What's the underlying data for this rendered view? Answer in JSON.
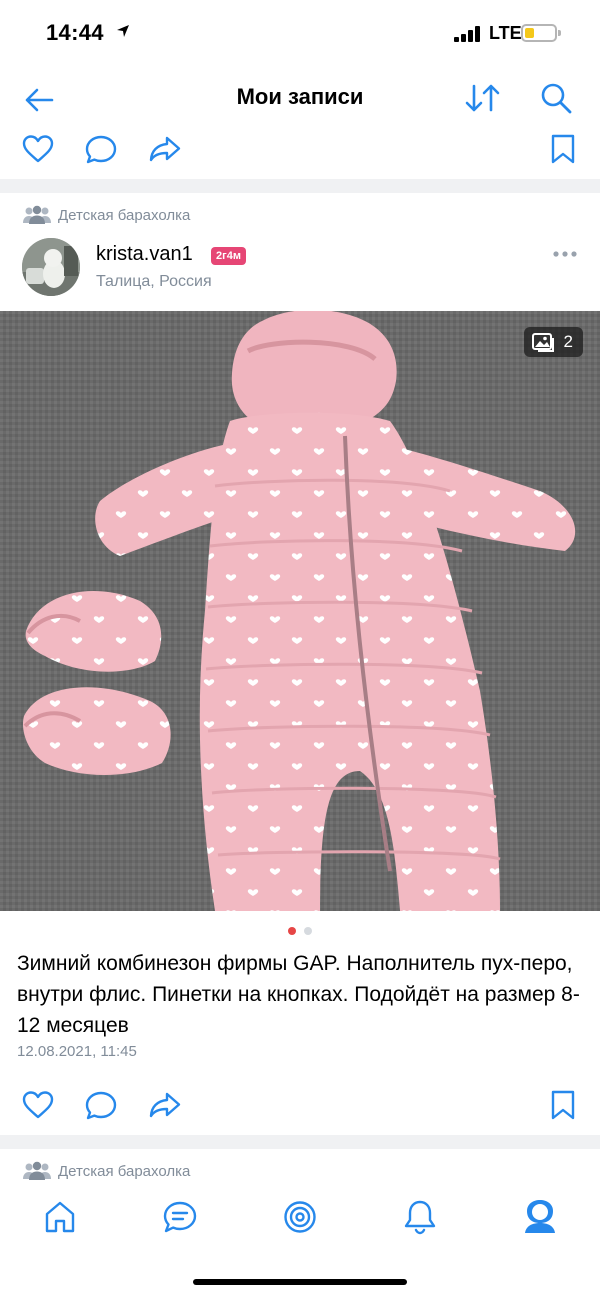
{
  "status_bar": {
    "time": "14:44",
    "network": "LTE",
    "battery_color": "#f4c81a"
  },
  "nav": {
    "title": "Мои записи"
  },
  "post": {
    "group": "Детская барахолка",
    "author": "krista.van1",
    "badge": "2г4м",
    "location": "Талица, Россия",
    "photo_count": "2",
    "photo_index": 1,
    "photo_total": 2,
    "text": "Зимний комбинезон фирмы GAP. Наполнитель пух-перо, внутри флис. Пинетки на кнопках. Подойдёт на размер 8-12 месяцев",
    "date": "12.08.2021, 11:45"
  },
  "next_post": {
    "group": "Детская барахолка"
  },
  "tabs": [
    {
      "icon": "home-icon"
    },
    {
      "icon": "messages-icon"
    },
    {
      "icon": "discover-icon"
    },
    {
      "icon": "notifications-bell-icon"
    },
    {
      "icon": "profile-icon"
    }
  ],
  "colors": {
    "accent": "#2688eb",
    "icon": "#2688eb",
    "gray": "#818c99",
    "badge": "#e64675",
    "dot_active": "#e64646"
  }
}
